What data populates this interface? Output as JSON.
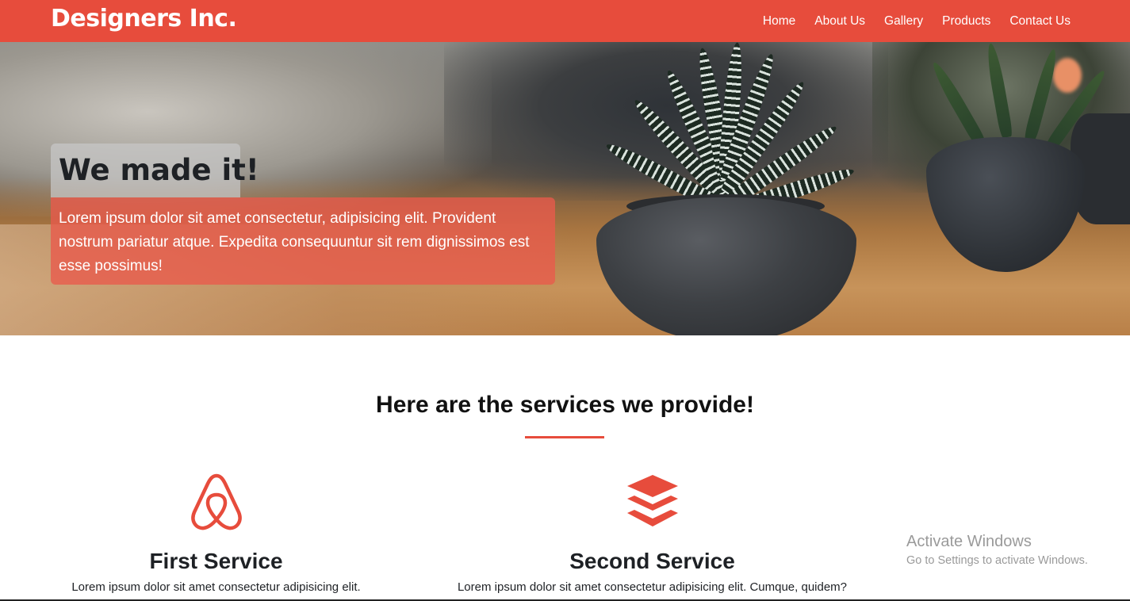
{
  "navbar": {
    "brand": "Designers Inc.",
    "links": [
      "Home",
      "About Us",
      "Gallery",
      "Products",
      "Contact Us"
    ],
    "background_color": "#e74c3c"
  },
  "hero": {
    "title": "We made it!",
    "text": "Lorem ipsum dolor sit amet consectetur, adipisicing elit. Provident nostrum pariatur atque. Expedita consequuntur sit rem dignissimos est esse possimus!",
    "image_subject": "potted-succulent-plant-icon"
  },
  "services": {
    "heading": "Here are the services we provide!",
    "accent_color": "#e74c3c",
    "items": [
      {
        "icon": "airbnb-icon",
        "title": "First Service",
        "text": "Lorem ipsum dolor sit amet consectetur adipisicing elit."
      },
      {
        "icon": "layers-icon",
        "title": "Second Service",
        "text": "Lorem ipsum dolor sit amet consectetur adipisicing elit. Cumque, quidem?"
      }
    ]
  },
  "watermark": {
    "title": "Activate Windows",
    "subtitle": "Go to Settings to activate Windows."
  }
}
